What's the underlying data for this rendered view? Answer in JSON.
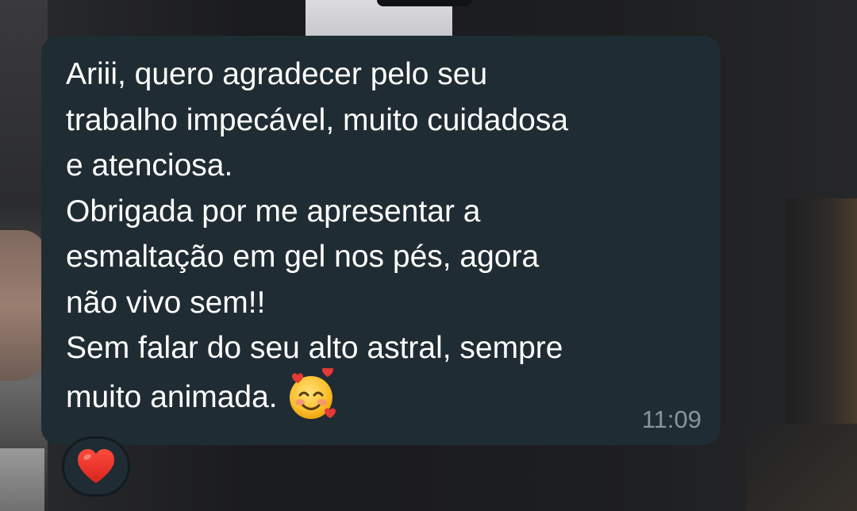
{
  "message": {
    "lines": [
      "Ariii, quero agradecer pelo seu",
      "trabalho impecável, muito cuidadosa",
      "e atenciosa.",
      "Obrigada por me apresentar a",
      "esmaltação em gel nos pés, agora",
      "não vivo sem!!",
      "Sem falar do seu alto astral, sempre",
      "muito animada."
    ],
    "emoji": "smiling-face-with-hearts-icon",
    "time": "11:09"
  },
  "reaction": {
    "emoji": "red-heart-icon"
  },
  "colors": {
    "bubble": "#202c33",
    "text": "#ffffff",
    "timestamp": "#8696a0",
    "heart": "#e0302a"
  }
}
